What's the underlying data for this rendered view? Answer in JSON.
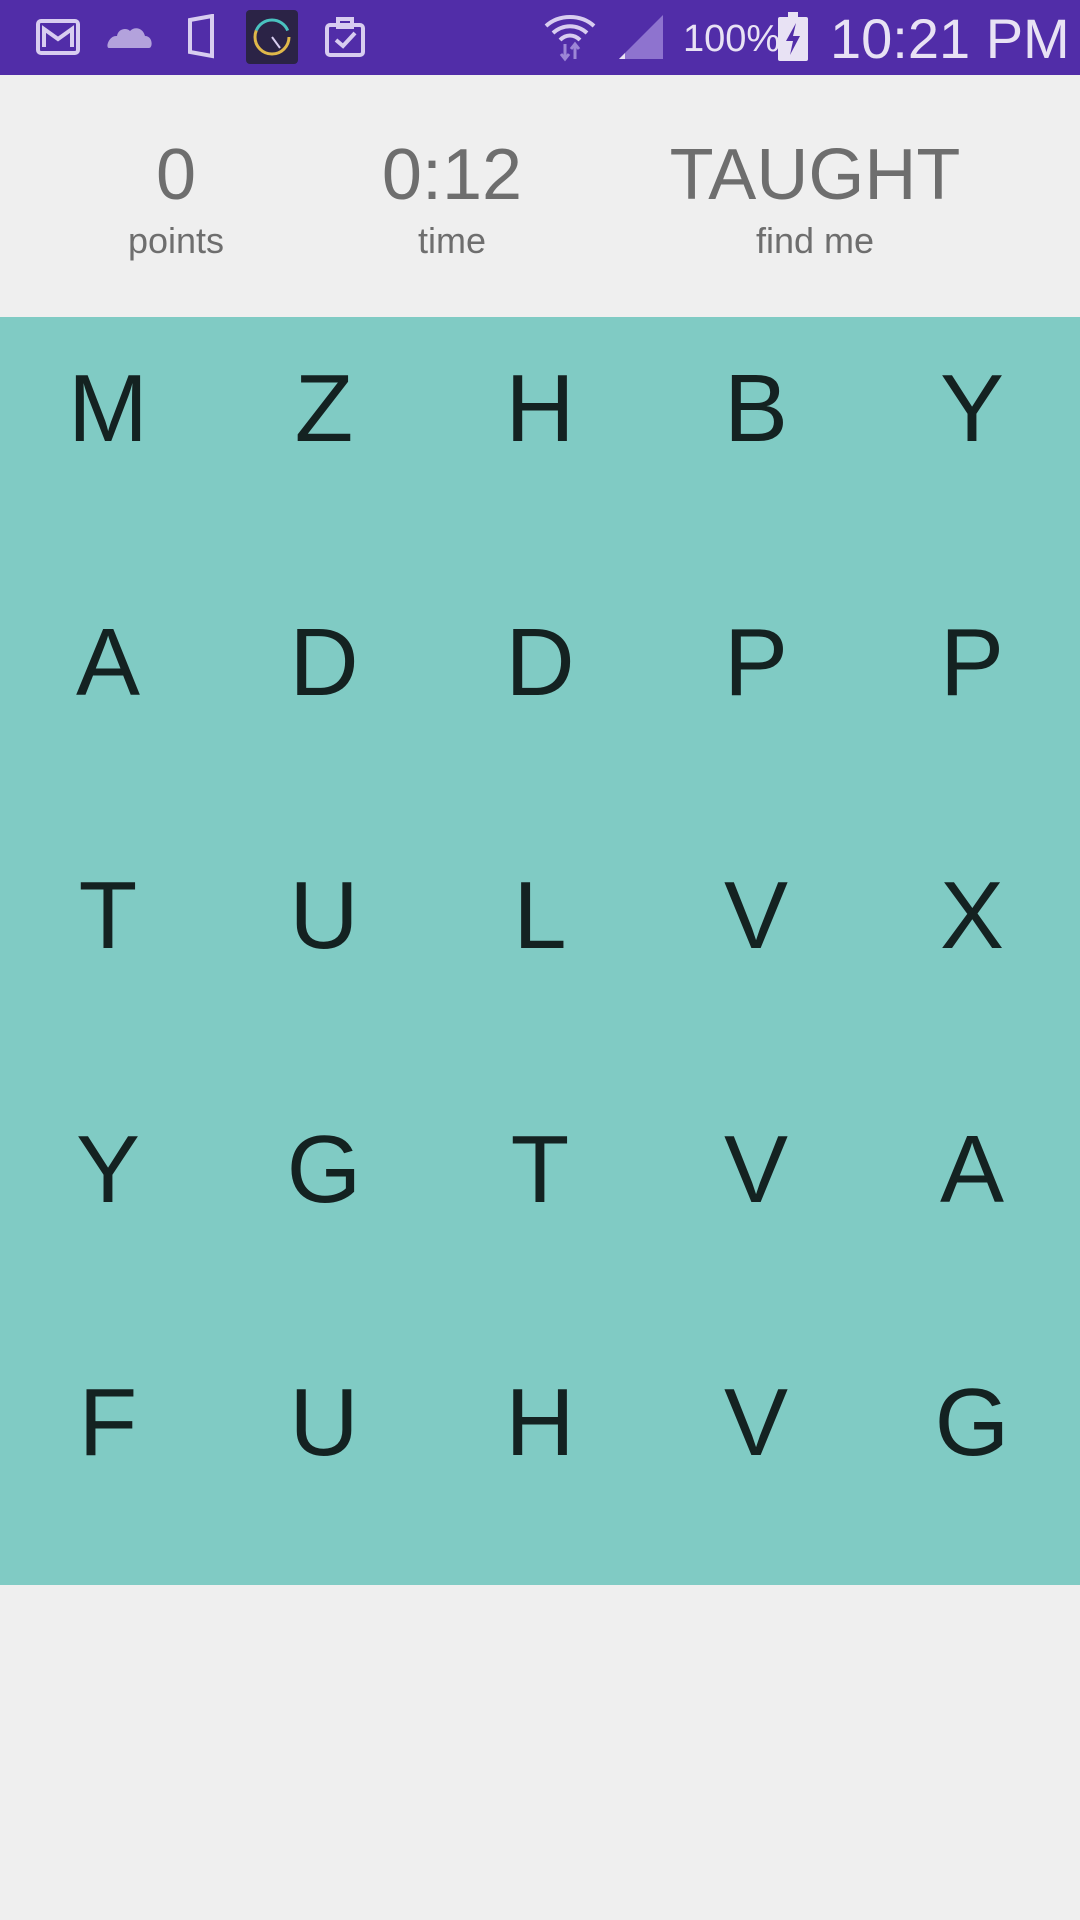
{
  "status_bar": {
    "icons_left": [
      "mail-icon",
      "cloud-icon",
      "phone-book-icon",
      "speed-gauge-icon",
      "clipboard-check-icon"
    ],
    "icons_right": [
      "wifi-icon",
      "signal-icon",
      "battery-charging-icon"
    ],
    "battery_percent": "100%",
    "time": "10:21 PM",
    "colors": {
      "background": "#512da8"
    }
  },
  "header": {
    "points": {
      "value": "0",
      "label": "points"
    },
    "time": {
      "value": "0:12",
      "label": "time"
    },
    "target": {
      "value": "TAUGHT",
      "label": "find me"
    }
  },
  "grid": {
    "background": "#80cbc4",
    "rows": [
      [
        "M",
        "Z",
        "H",
        "B",
        "Y"
      ],
      [
        "A",
        "D",
        "D",
        "P",
        "P"
      ],
      [
        "T",
        "U",
        "L",
        "V",
        "X"
      ],
      [
        "Y",
        "G",
        "T",
        "V",
        "A"
      ],
      [
        "F",
        "U",
        "H",
        "V",
        "G"
      ]
    ]
  }
}
